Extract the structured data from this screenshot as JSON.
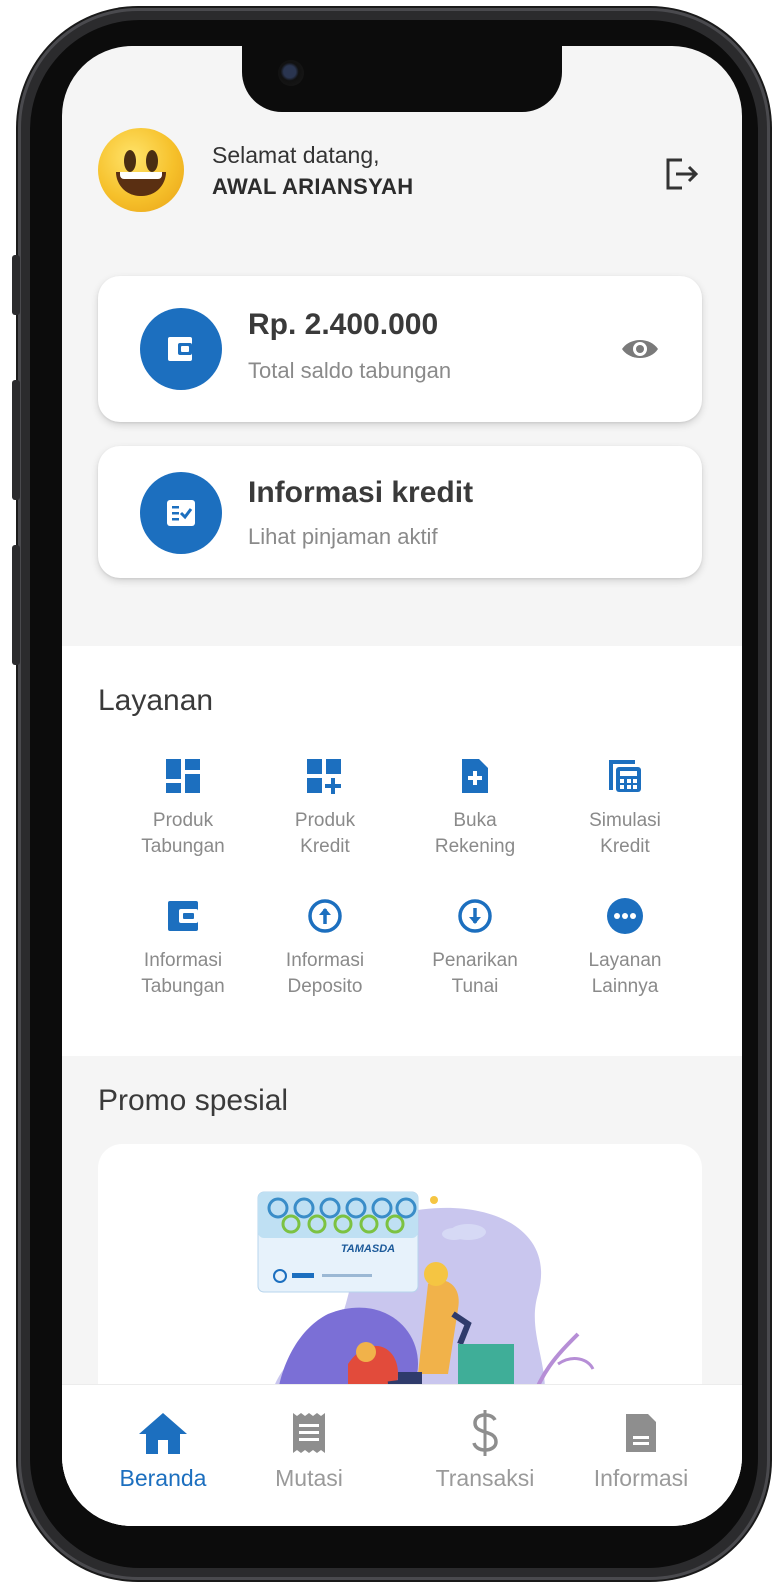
{
  "header": {
    "greeting": "Selamat datang,",
    "username": "AWAL ARIANSYAH"
  },
  "balance_card": {
    "amount": "Rp. 2.400.000",
    "subtitle": "Total saldo tabungan"
  },
  "credit_card": {
    "title": "Informasi kredit",
    "subtitle": "Lihat pinjaman aktif"
  },
  "services": {
    "title": "Layanan",
    "items": [
      {
        "line1": "Produk",
        "line2": "Tabungan",
        "icon": "dashboard-icon"
      },
      {
        "line1": "Produk",
        "line2": "Kredit",
        "icon": "dashboard-add-icon"
      },
      {
        "line1": "Buka",
        "line2": "Rekening",
        "icon": "file-add-icon"
      },
      {
        "line1": "Simulasi",
        "line2": "Kredit",
        "icon": "calculator-icon"
      },
      {
        "line1": "Informasi",
        "line2": "Tabungan",
        "icon": "wallet-icon"
      },
      {
        "line1": "Informasi",
        "line2": "Deposito",
        "icon": "arrow-up-circle-icon"
      },
      {
        "line1": "Penarikan",
        "line2": "Tunai",
        "icon": "arrow-down-circle-icon"
      },
      {
        "line1": "Layanan",
        "line2": "Lainnya",
        "icon": "more-icon"
      }
    ]
  },
  "promo": {
    "title": "Promo spesial",
    "card_brand": "TAMASDA"
  },
  "bottom_nav": {
    "items": [
      {
        "label": "Beranda",
        "icon": "home-icon",
        "active": true
      },
      {
        "label": "Mutasi",
        "icon": "receipt-icon",
        "active": false
      },
      {
        "label": "Transaksi",
        "icon": "dollar-icon",
        "active": false
      },
      {
        "label": "Informasi",
        "icon": "document-icon",
        "active": false
      }
    ]
  },
  "colors": {
    "primary": "#1c6fbf",
    "text": "#3a3a3a",
    "muted": "#8a8a8a",
    "background": "#f5f5f5"
  }
}
